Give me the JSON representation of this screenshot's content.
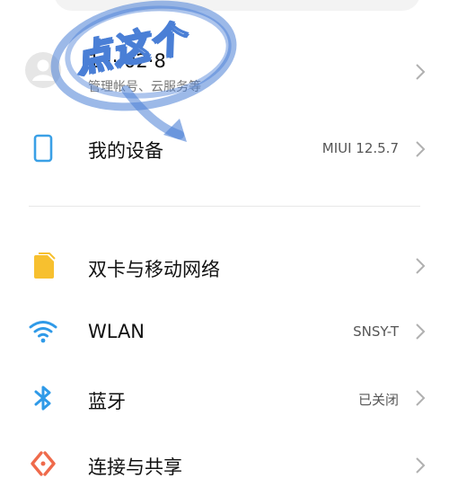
{
  "account": {
    "name": "1····02·8",
    "subtitle": "管理帐号、云服务等"
  },
  "device": {
    "label": "我的设备",
    "value": "MIUI 12.5.7"
  },
  "settings": [
    {
      "label": "双卡与移动网络",
      "value": "",
      "icon": "sim-card-icon"
    },
    {
      "label": "WLAN",
      "value": "SNSY-T",
      "icon": "wifi-icon"
    },
    {
      "label": "蓝牙",
      "value": "已关闭",
      "icon": "bluetooth-icon"
    },
    {
      "label": "连接与共享",
      "value": "",
      "icon": "connection-share-icon"
    }
  ],
  "annotation": {
    "text": "点这个"
  },
  "colors": {
    "sim": "#f7c02f",
    "wifi": "#2f9ae8",
    "bluetooth": "#2f9ae8",
    "share": "#ef6a4b",
    "device": "#3aa0e6",
    "annotation": "#4a7fd6"
  }
}
